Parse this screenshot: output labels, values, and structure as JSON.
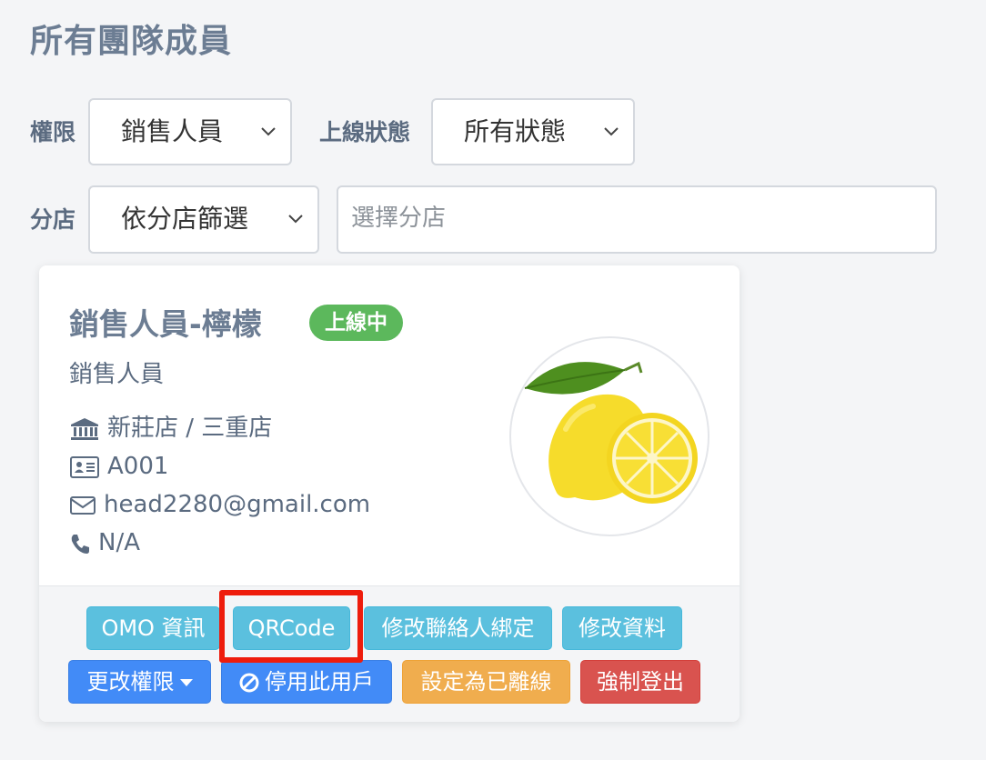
{
  "page": {
    "title": "所有團隊成員"
  },
  "filters": {
    "permission_label": "權限",
    "permission_value": "銷售人員",
    "online_status_label": "上線狀態",
    "online_status_value": "所有狀態",
    "branch_label": "分店",
    "branch_filter_value": "依分店篩選",
    "branch_input_placeholder": "選擇分店"
  },
  "member": {
    "name": "銷售人員-檸檬",
    "status_badge": "上線中",
    "role": "銷售人員",
    "branches": "新莊店 / 三重店",
    "id": "A001",
    "email": "head2280@gmail.com",
    "phone": "N/A",
    "avatar": "lemon-avatar"
  },
  "actions": {
    "omo_info": "OMO 資訊",
    "qrcode": "QRCode",
    "edit_contact_binding": "修改聯絡人綁定",
    "edit_info": "修改資料",
    "change_permission": "更改權限",
    "disable_user": "停用此用戶",
    "set_offline": "設定為已離線",
    "force_logout": "強制登出"
  },
  "colors": {
    "badge_online": "#5cb85c",
    "btn_info": "#5bc0de",
    "btn_primary": "#428bf7",
    "btn_warning": "#f0ad4e",
    "btn_danger": "#d9534f",
    "highlight": "#ee1c0c"
  }
}
